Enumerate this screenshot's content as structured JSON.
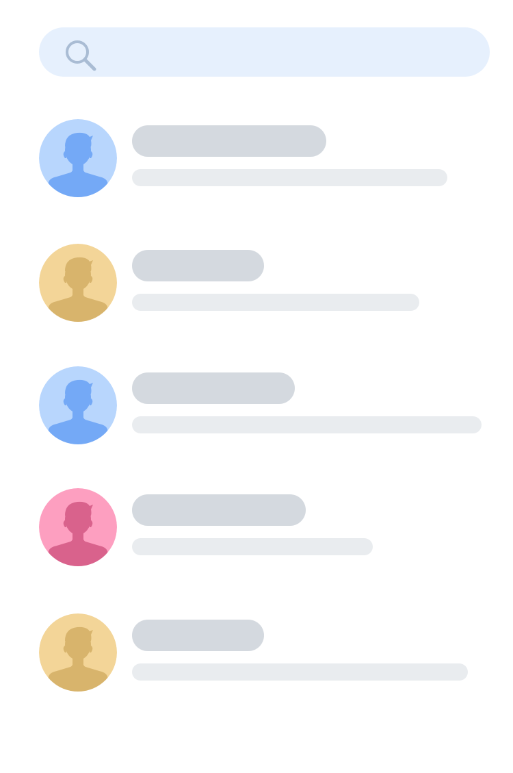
{
  "search": {
    "icon": "search-icon",
    "background_color": "#e6f0fd",
    "icon_color": "#a9bcd4"
  },
  "placeholder_colors": {
    "name_bar": "#d4d9df",
    "detail_bar": "#e9ecef"
  },
  "contacts": [
    {
      "avatar_icon": "person-silhouette-icon",
      "avatar_bg": "#b8d6fd",
      "avatar_fg": "#74a9f6"
    },
    {
      "avatar_icon": "person-silhouette-icon",
      "avatar_bg": "#f3d598",
      "avatar_fg": "#d8b46c"
    },
    {
      "avatar_icon": "person-silhouette-icon",
      "avatar_bg": "#b8d6fd",
      "avatar_fg": "#74a9f6"
    },
    {
      "avatar_icon": "person-silhouette-icon",
      "avatar_bg": "#fd9fc0",
      "avatar_fg": "#d9628c"
    },
    {
      "avatar_icon": "person-silhouette-icon",
      "avatar_bg": "#f3d598",
      "avatar_fg": "#d8b46c"
    }
  ]
}
